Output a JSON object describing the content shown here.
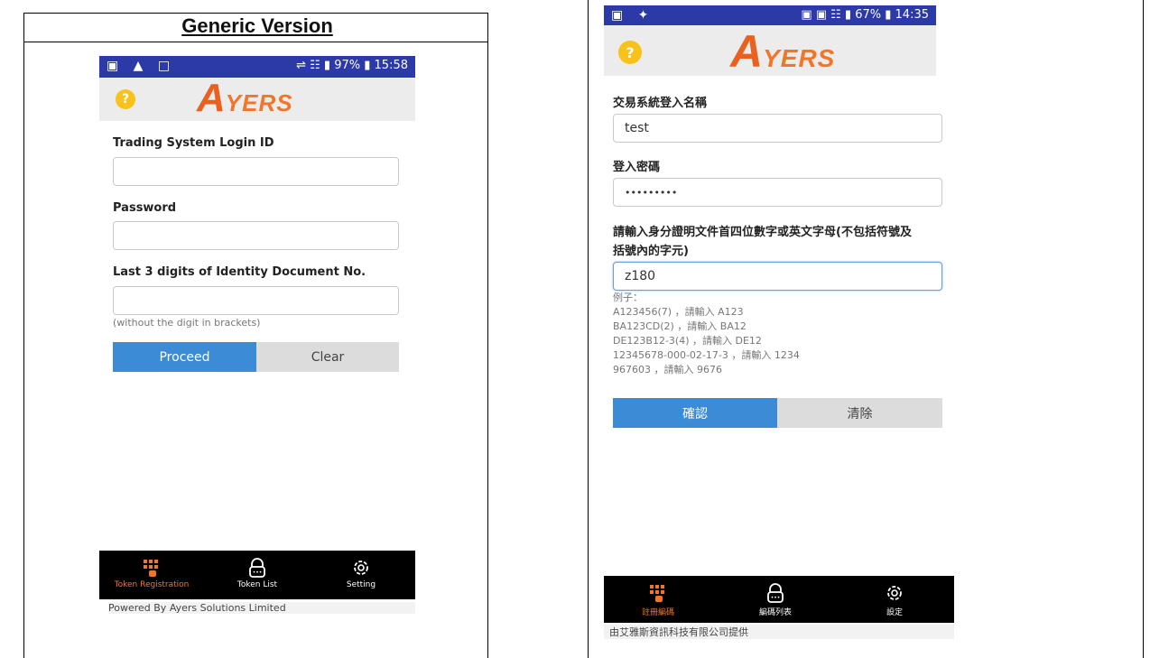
{
  "doc": {
    "title": "Generic Version"
  },
  "left_phone": {
    "status_left": "▣ ▲ □",
    "status_right": "⇌ ☷ ▮ 97% ▮ 15:58",
    "help_glyph": "?",
    "logo_a": "A",
    "logo_rest": "YERS",
    "login_label": "Trading System Login ID",
    "login_value": "",
    "password_label": "Password",
    "password_value": "",
    "id_label": "Last 3 digits of Identity Document No.",
    "id_value": "",
    "id_hint": "(without the digit in brackets)",
    "proceed": "Proceed",
    "clear": "Clear",
    "tabs": [
      "Token Registration",
      "Token List",
      "Setting"
    ],
    "powered": "Powered By Ayers Solutions Limited"
  },
  "right_phone": {
    "status_left": "▣ ✦",
    "status_right": "▣ ▣ ☷ ▮ 67% ▮ 14:35",
    "help_glyph": "?",
    "logo_a": "A",
    "logo_rest": "YERS",
    "login_label": "交易系統登入名稱",
    "login_value": "test",
    "password_label": "登入密碼",
    "password_value": "•••••••••",
    "id_label_1": "請輸入身分證明文件首四位數字或英文字母(不包括符號及",
    "id_label_2": "括號內的字元)",
    "id_value": "z180",
    "examples": [
      "例子：",
      "A123456(7) ，請輸入 A123",
      "BA123CD(2) ，請輸入 BA12",
      "DE123B12-3(4) ，請輸入 DE12",
      "12345678-000-02-17-3 ，請輸入 1234",
      "967603 ，請輸入 9676"
    ],
    "confirm": "確認",
    "clear": "清除",
    "tabs": [
      "註冊編碼",
      "編碼列表",
      "設定"
    ],
    "powered": "由艾雅斯資訊科技有限公司提供"
  },
  "colors": {
    "accent": "#3b8bd6",
    "brand": "#f2762a",
    "statusbar": "#2b3aa6"
  },
  "icons": [
    "help-icon",
    "keypad-icon",
    "lock-icon",
    "gear-icon"
  ]
}
